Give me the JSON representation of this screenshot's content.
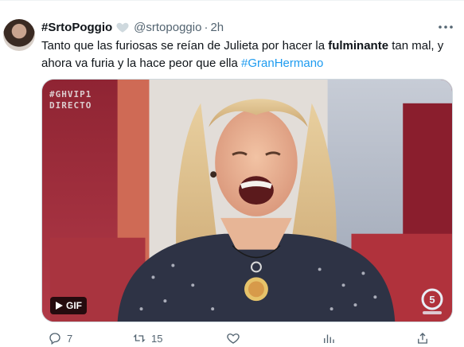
{
  "tweet": {
    "display_name": "#SrtoPoggio",
    "handle": "@srtopoggio",
    "separator": "·",
    "time": "2h",
    "text_before": "Tanto que las furiosas se reían de Julieta por hacer la ",
    "text_bold": "fulminante",
    "text_after": " tan mal, y ahora va furia y la hace peor que ella ",
    "hashtag": "#GranHermano"
  },
  "media": {
    "overlay_line1": "#GHVIP1",
    "overlay_line2": "DIRECTO",
    "gif_label": "GIF"
  },
  "actions": {
    "reply_count": "7",
    "retweet_count": "15",
    "like_count": "",
    "views_count": "",
    "share_label": ""
  },
  "colors": {
    "accent": "#1d9bf0",
    "text_primary": "#0f1419",
    "text_secondary": "#536471"
  }
}
